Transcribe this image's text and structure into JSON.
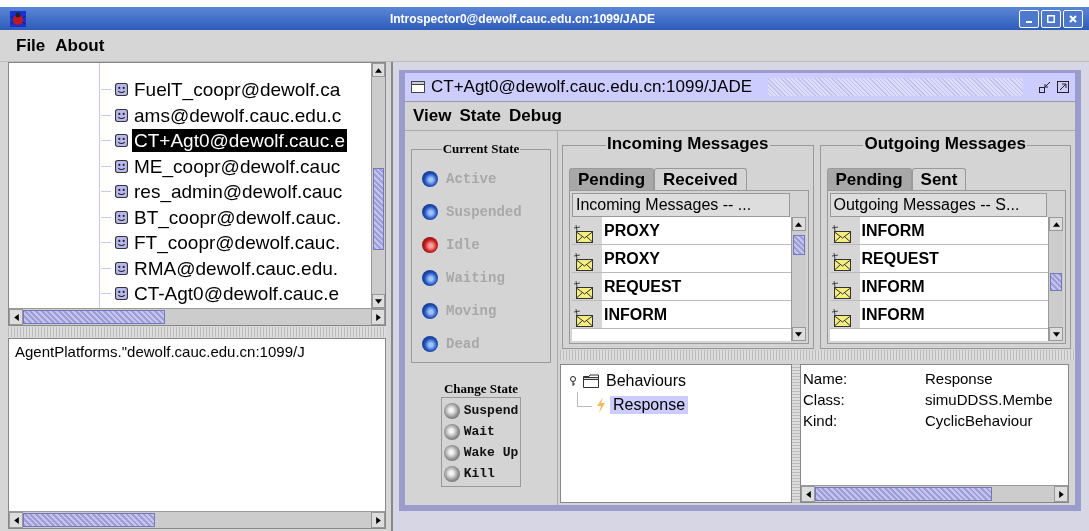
{
  "window": {
    "title": "Introspector0@dewolf.cauc.edu.cn:1099/JADE"
  },
  "menu": [
    "File",
    "About"
  ],
  "agent_tree": {
    "items": [
      {
        "label": "FuelT_coopr@dewolf.ca",
        "selected": false
      },
      {
        "label": "ams@dewolf.cauc.edu.c",
        "selected": false
      },
      {
        "label": "CT+Agt0@dewolf.cauc.e",
        "selected": true
      },
      {
        "label": "ME_coopr@dewolf.cauc",
        "selected": false
      },
      {
        "label": "res_admin@dewolf.cauc",
        "selected": false
      },
      {
        "label": "BT_coopr@dewolf.cauc.",
        "selected": false
      },
      {
        "label": "FT_coopr@dewolf.cauc.",
        "selected": false
      },
      {
        "label": "RMA@dewolf.cauc.edu.",
        "selected": false
      },
      {
        "label": "CT-Agt0@dewolf.cauc.e",
        "selected": false
      }
    ]
  },
  "platform_text": "AgentPlatforms.\"dewolf.cauc.edu.cn:1099/J",
  "agent_window": {
    "title": "CT+Agt0@dewolf.cauc.edu.cn:1099/JADE",
    "menu": [
      "View",
      "State",
      "Debug"
    ],
    "current_state": {
      "title": "Current State",
      "states": [
        {
          "label": "Active",
          "selected": false
        },
        {
          "label": "Suspended",
          "selected": false
        },
        {
          "label": "Idle",
          "selected": true
        },
        {
          "label": "Waiting",
          "selected": false
        },
        {
          "label": "Moving",
          "selected": false
        },
        {
          "label": "Dead",
          "selected": false
        }
      ]
    },
    "incoming": {
      "title": "Incoming Messages",
      "tabs": [
        {
          "label": "Pending",
          "selected": false
        },
        {
          "label": "Received",
          "selected": true
        }
      ],
      "column": "Incoming Messages --  ...",
      "rows": [
        "PROXY",
        "PROXY",
        "REQUEST",
        "INFORM"
      ]
    },
    "outgoing": {
      "title": "Outgoing Messages",
      "tabs": [
        {
          "label": "Pending",
          "selected": false
        },
        {
          "label": "Sent",
          "selected": true
        }
      ],
      "column": "Outgoing Messages -- S...",
      "rows": [
        "INFORM",
        "REQUEST",
        "INFORM",
        "INFORM"
      ]
    },
    "change_state": {
      "title": "Change State",
      "buttons": [
        "Suspend",
        "Wait",
        "Wake Up",
        "Kill"
      ]
    },
    "behaviours": {
      "label": "Behaviours",
      "expanded": true,
      "children": [
        {
          "label": "Response",
          "selected": true
        }
      ]
    },
    "details": [
      {
        "label": "Name:",
        "value": "Response"
      },
      {
        "label": "Class:",
        "value": "simuDDSS.Membe"
      },
      {
        "label": "Kind:",
        "value": "CyclicBehaviour"
      }
    ]
  }
}
